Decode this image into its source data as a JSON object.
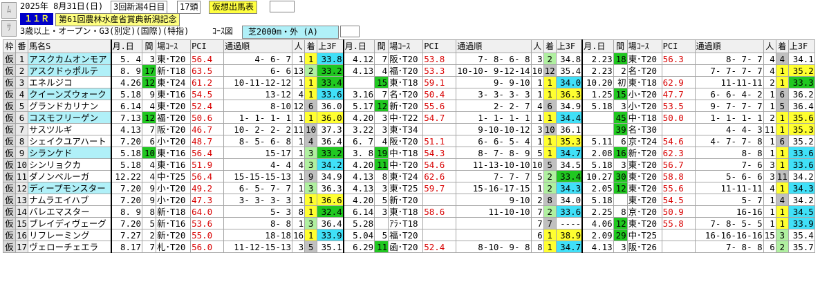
{
  "race": {
    "date": "2025年 8月31日(日)",
    "meeting": "3回新潟4日目",
    "heads": "17頭",
    "mode": "仮想出馬表",
    "num": "１１Ｒ",
    "name": "第61回農林水産省賞典新潟記念",
    "cond": "3歳以上・オープン・G3(別定)(国際)(特指)",
    "course_label": "ｺｰｽ図",
    "course": "芝2000m・外 (A)"
  },
  "side": {
    "up": "ﾑ",
    "down": "ｻ"
  },
  "headers": {
    "waku": "枠",
    "ban": "番",
    "name": "馬名S",
    "date": "月.日",
    "interval": "間",
    "place": "場ｺｰｽ",
    "pci": "PCI",
    "passing": "通過順",
    "pop": "人",
    "finish": "着",
    "l3f": "上3F"
  },
  "horses": [
    {
      "waku": "仮",
      "ban": "1",
      "name": "アスクカムオンモア",
      "runs": [
        [
          "5. 4",
          "3",
          "東･T20",
          "56.4",
          "4- 6- 7",
          "1",
          "1",
          "33.8"
        ],
        [
          "4.12",
          "7",
          "阪･T20",
          "53.8",
          "7- 8- 6- 8",
          "3",
          "2",
          "34.8"
        ],
        [
          "2.23",
          "18",
          "東･T20",
          "56.3",
          "8- 7- 7",
          "4",
          "4",
          "34.1"
        ]
      ]
    },
    {
      "waku": "仮",
      "ban": "2",
      "name": "アスクドゥポルテ",
      "runs": [
        [
          "8. 9",
          "17",
          "新･T18",
          "63.5",
          "6- 6",
          "13",
          "2",
          "33.2"
        ],
        [
          "4.13",
          "4",
          "福･T20",
          "53.3",
          "10-10- 9-12-14",
          "10",
          "12",
          "35.4"
        ],
        [
          "2.23",
          "2",
          "名･T20",
          "",
          "7- 7- 7- 7",
          "4",
          "1",
          "35.2"
        ]
      ]
    },
    {
      "waku": "仮",
      "ban": "3",
      "name": "エネルジコ",
      "runs": [
        [
          "4.26",
          "12",
          "東･T24",
          "61.2",
          "10-11-12-12",
          "1",
          "1",
          "33.4"
        ],
        [
          "",
          "15",
          "東･T18",
          "59.1",
          "9- 9-10",
          "1",
          "1",
          "34.0"
        ],
        [
          "10.20",
          "初",
          "東･T18",
          "62.9",
          "11-11-11",
          "2",
          "1",
          "33.3"
        ]
      ]
    },
    {
      "waku": "仮",
      "ban": "4",
      "name": "クイーンズウォーク",
      "runs": [
        [
          "5.18",
          "9",
          "東･T16",
          "54.5",
          "13-12",
          "4",
          "1",
          "33.6"
        ],
        [
          "3.16",
          "7",
          "名･T20",
          "50.4",
          "3- 3- 3- 3",
          "1",
          "1",
          "36.3"
        ],
        [
          "1.25",
          "15",
          "小･T20",
          "47.7",
          "6- 6- 4- 2",
          "1",
          "6",
          "36.2"
        ]
      ]
    },
    {
      "waku": "仮",
      "ban": "5",
      "name": "グランドカリナン",
      "runs": [
        [
          "6.14",
          "4",
          "東･T20",
          "52.4",
          "8-10",
          "12",
          "6",
          "36.0"
        ],
        [
          "5.17",
          "12",
          "新･T20",
          "55.6",
          "2- 2- 7",
          "4",
          "6",
          "34.9"
        ],
        [
          "5.18",
          "3",
          "小･T20",
          "53.5",
          "9- 7- 7- 7",
          "1",
          "5",
          "36.4"
        ]
      ]
    },
    {
      "waku": "仮",
      "ban": "6",
      "name": "コスモフリーゲン",
      "runs": [
        [
          "7.13",
          "12",
          "福･T20",
          "50.6",
          "1- 1- 1- 1",
          "1",
          "1",
          "36.0"
        ],
        [
          "4.20",
          "3",
          "中･T22",
          "54.7",
          "1- 1- 1- 1",
          "1",
          "1",
          "34.4"
        ],
        [
          "",
          "45",
          "中･T18",
          "50.0",
          "1- 1- 1- 1",
          "2",
          "1",
          "35.6"
        ]
      ]
    },
    {
      "waku": "仮",
      "ban": "7",
      "name": "サスツルギ",
      "runs": [
        [
          "4.13",
          "7",
          "阪･T20",
          "46.7",
          "10- 2- 2- 2",
          "11",
          "10",
          "37.3"
        ],
        [
          "3.22",
          "3",
          "東･T34",
          "",
          "9-10-10-12",
          "3",
          "10",
          "36.1"
        ],
        [
          "",
          "39",
          "名･T30",
          "",
          "4- 4- 3",
          "11",
          "1",
          "35.3"
        ]
      ]
    },
    {
      "waku": "仮",
      "ban": "8",
      "name": "シェイクユアハート",
      "runs": [
        [
          "7.20",
          "6",
          "小･T20",
          "48.7",
          "8- 5- 6- 8",
          "1",
          "4",
          "36.4"
        ],
        [
          "6. 7",
          "4",
          "阪･T20",
          "51.1",
          "6- 6- 5- 4",
          "1",
          "1",
          "35.3"
        ],
        [
          "5.11",
          "6",
          "京･T24",
          "54.6",
          "4- 7- 7- 8",
          "1",
          "6",
          "35.2"
        ]
      ]
    },
    {
      "waku": "仮",
      "ban": "9",
      "name": "シランケド",
      "runs": [
        [
          "5.18",
          "10",
          "東･T16",
          "56.4",
          "15-17",
          "1",
          "3",
          "33.2"
        ],
        [
          "3. 8",
          "19",
          "中･T18",
          "54.3",
          "8- 7- 8- 9",
          "5",
          "1",
          "34.7"
        ],
        [
          "2.08",
          "16",
          "新･T20",
          "62.3",
          "8- 8",
          "1",
          "1",
          "33.6"
        ]
      ]
    },
    {
      "waku": "仮",
      "ban": "10",
      "name": "シンリョクカ",
      "runs": [
        [
          "5.18",
          "4",
          "東･T16",
          "51.9",
          "4- 4",
          "4",
          "3",
          "34.2"
        ],
        [
          "4.20",
          "11",
          "中･T20",
          "54.6",
          "11-13-10-10",
          "10",
          "5",
          "34.5"
        ],
        [
          "5.18",
          "3",
          "東･T20",
          "56.7",
          "7- 6",
          "3",
          "1",
          "33.6"
        ]
      ]
    },
    {
      "waku": "仮",
      "ban": "11",
      "name": "ダノンベルーガ",
      "runs": [
        [
          "12.22",
          "4",
          "中･T25",
          "56.4",
          "15-15-15-13",
          "1",
          "9",
          "34.9"
        ],
        [
          "4.13",
          "8",
          "東･T24",
          "62.6",
          "7- 7- 7",
          "5",
          "2",
          "33.4"
        ],
        [
          "10.27",
          "30",
          "東･T20",
          "58.8",
          "5- 6- 6",
          "3",
          "11",
          "34.2"
        ]
      ]
    },
    {
      "waku": "仮",
      "ban": "12",
      "name": "ディープモンスター",
      "runs": [
        [
          "7.20",
          "9",
          "小･T20",
          "49.2",
          "6- 5- 7- 7",
          "1",
          "3",
          "36.3"
        ],
        [
          "4.13",
          "3",
          "東･T25",
          "59.7",
          "15-16-17-15",
          "1",
          "2",
          "34.3"
        ],
        [
          "2.05",
          "12",
          "東･T20",
          "55.6",
          "11-11-11",
          "4",
          "1",
          "34.3"
        ]
      ]
    },
    {
      "waku": "仮",
      "ban": "13",
      "name": "ナムラエイハブ",
      "runs": [
        [
          "7.20",
          "9",
          "小･T20",
          "47.3",
          "3- 3- 3- 3",
          "1",
          "1",
          "36.6"
        ],
        [
          "4.20",
          "5",
          "新･T20",
          "",
          "9-10",
          "2",
          "8",
          "34.0"
        ],
        [
          "5.18",
          "",
          "東･T20",
          "54.5",
          "5- 7",
          "1",
          "4",
          "34.2"
        ]
      ]
    },
    {
      "waku": "仮",
      "ban": "14",
      "name": "バレエマスター",
      "runs": [
        [
          "8. 9",
          "8",
          "新･T18",
          "64.0",
          "5- 3",
          "8",
          "1",
          "32.4"
        ],
        [
          "6.14",
          "3",
          "東･T18",
          "58.6",
          "11-10-10",
          "7",
          "2",
          "33.6"
        ],
        [
          "2.25",
          "8",
          "京･T20",
          "50.9",
          "16-16",
          "1",
          "1",
          "34.5"
        ]
      ]
    },
    {
      "waku": "仮",
      "ban": "15",
      "name": "ブレイディヴェーグ",
      "runs": [
        [
          "7.20",
          "5",
          "新･T16",
          "53.6",
          "8- 8",
          "1",
          "3",
          "36.4"
        ],
        [
          "5.28",
          "",
          "ｱﾗ･T18",
          "",
          "",
          "7",
          "7",
          "----"
        ],
        [
          "4.06",
          "12",
          "東･T20",
          "55.8",
          "7- 8- 5- 5",
          "1",
          "1",
          "33.9"
        ]
      ]
    },
    {
      "waku": "仮",
      "ban": "16",
      "name": "リフレーミング",
      "runs": [
        [
          "7.27",
          "2",
          "新･T20",
          "55.0",
          "18-18",
          "16",
          "1",
          "33.9"
        ],
        [
          "5.04",
          "5",
          "福･T20",
          "",
          "",
          "6",
          "1",
          "38.9"
        ],
        [
          "2.09",
          "29",
          "中･T25",
          "",
          "16-16-16-16",
          "15",
          "3",
          "35.4"
        ]
      ]
    },
    {
      "waku": "仮",
      "ban": "17",
      "name": "ヴェローチェエラ",
      "runs": [
        [
          "8.17",
          "7",
          "札･T20",
          "56.0",
          "11-12-15-13",
          "3",
          "5",
          "35.1"
        ],
        [
          "6.29",
          "11",
          "函･T20",
          "52.4",
          "8-10- 9- 8",
          "8",
          "1",
          "34.7"
        ],
        [
          "4.13",
          "3",
          "阪･T26",
          "",
          "7- 8- 8",
          "6",
          "2",
          "35.7"
        ]
      ]
    }
  ],
  "colors": {
    "finish1": "#ffff30",
    "l3f_fast": "#40e0f8",
    "int_green": "#20c820"
  }
}
